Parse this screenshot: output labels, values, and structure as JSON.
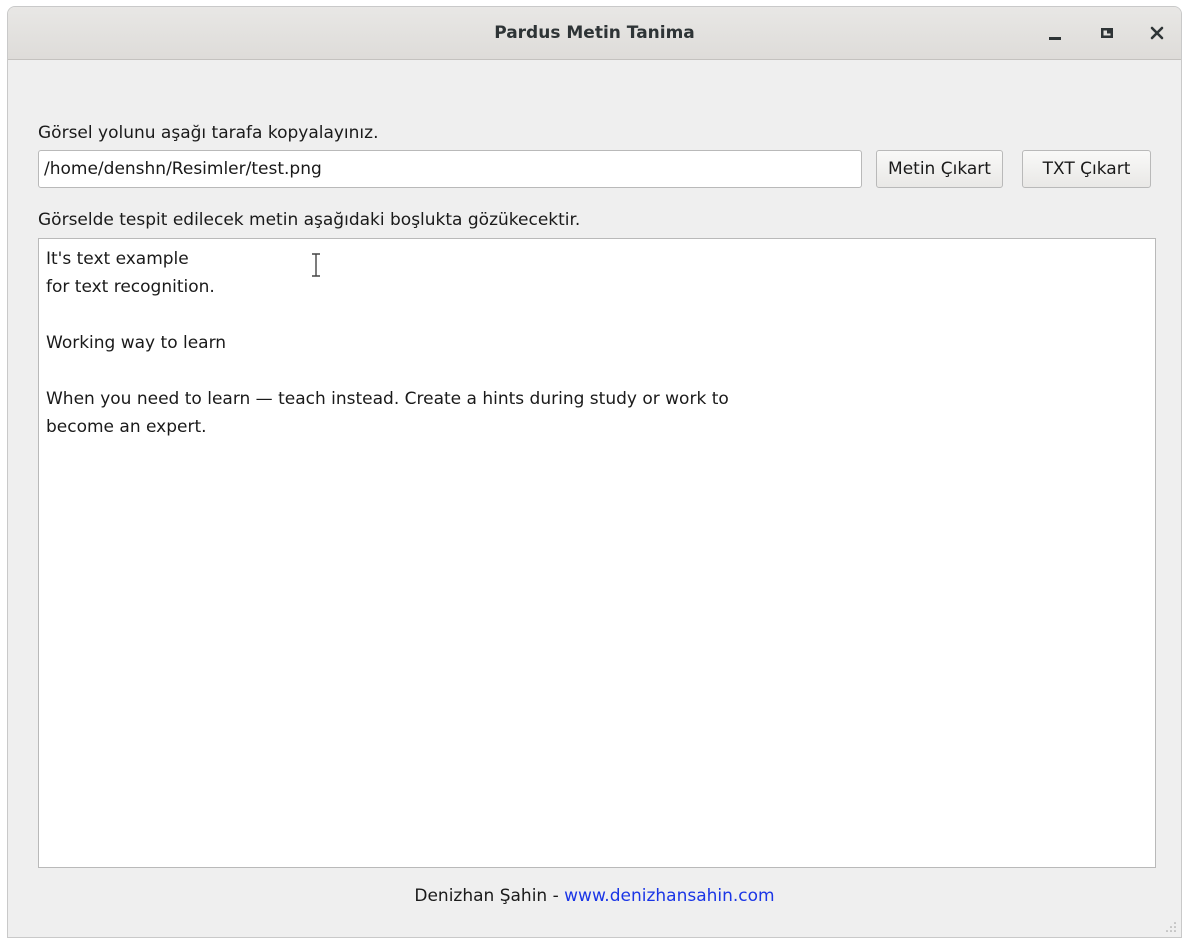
{
  "window": {
    "title": "Pardus Metin Tanima",
    "controls": {
      "minimize_icon": "minimize-icon",
      "maximize_icon": "maximize-icon",
      "close_icon": "close-icon"
    }
  },
  "form": {
    "path_label": "Görsel yolunu aşağı tarafa kopyalayınız.",
    "path_value": "/home/denshn/Resimler/test.png",
    "extract_button": "Metin Çıkart",
    "txt_button": "TXT Çıkart",
    "result_label": "Görselde tespit edilecek metin aşağıdaki boşlukta gözükecektir.",
    "result_text": "It's text example\nfor text recognition.\n\nWorking way to learn\n\nWhen you need to learn — teach instead. Create a hints during study or work to\nbecome an expert."
  },
  "footer": {
    "author": "Denizhan Şahin",
    "separator": " - ",
    "link": "www.denizhansahin.com"
  },
  "colors": {
    "link": "#1a35e6",
    "window_bg": "#efefef"
  }
}
